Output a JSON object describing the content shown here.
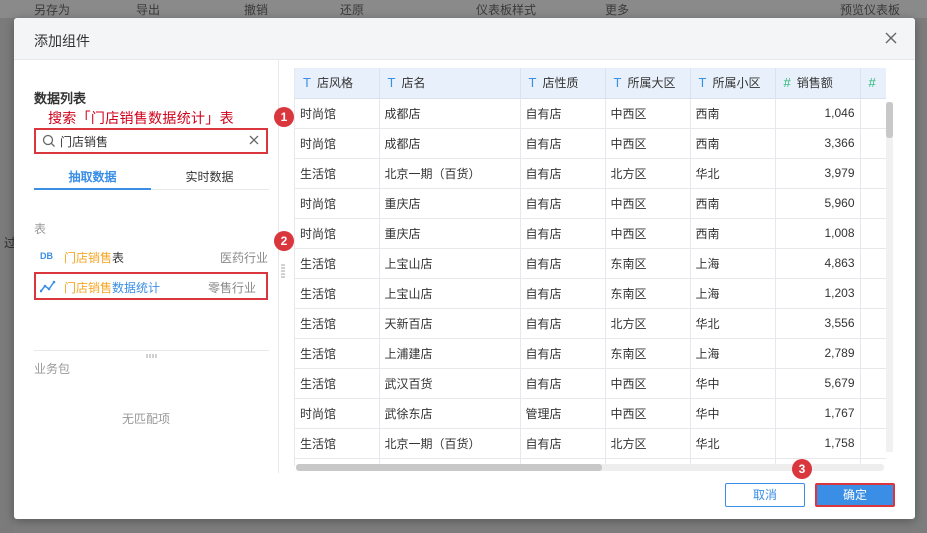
{
  "background_toolbar": {
    "items": [
      "另存为",
      "导出",
      "撤销",
      "还原",
      "仪表板样式",
      "更多",
      "预览仪表板"
    ],
    "side_text": "过"
  },
  "dialog": {
    "title": "添加组件"
  },
  "left_panel": {
    "datalist_label": "数据列表",
    "annotation": "搜索「门店销售数据统计」表",
    "search": {
      "value": "门店销售",
      "placeholder": ""
    },
    "tabs": [
      {
        "label": "抽取数据",
        "active": true
      },
      {
        "label": "实时数据",
        "active": false
      }
    ],
    "table_section_label": "表",
    "tables": [
      {
        "icon": "DB",
        "highlight": "门店销售",
        "rest": "表",
        "industry": "医药行业",
        "selected": false
      },
      {
        "icon": "chart",
        "highlight": "门店销售",
        "rest": "数据统计",
        "industry": "零售行业",
        "selected": true
      }
    ],
    "business_pack_label": "业务包",
    "empty_text": "无匹配项"
  },
  "data_table": {
    "columns": [
      {
        "type": "T",
        "label": "店风格"
      },
      {
        "type": "T",
        "label": "店名"
      },
      {
        "type": "T",
        "label": "店性质"
      },
      {
        "type": "T",
        "label": "所属大区"
      },
      {
        "type": "T",
        "label": "所属小区"
      },
      {
        "type": "#",
        "label": "销售额"
      },
      {
        "type": "#",
        "label": ""
      }
    ],
    "rows": [
      [
        "时尚馆",
        "成都店",
        "自有店",
        "中西区",
        "西南",
        "1,046"
      ],
      [
        "时尚馆",
        "成都店",
        "自有店",
        "中西区",
        "西南",
        "3,366"
      ],
      [
        "生活馆",
        "北京一期（百货）",
        "自有店",
        "北方区",
        "华北",
        "3,979"
      ],
      [
        "时尚馆",
        "重庆店",
        "自有店",
        "中西区",
        "西南",
        "5,960"
      ],
      [
        "时尚馆",
        "重庆店",
        "自有店",
        "中西区",
        "西南",
        "1,008"
      ],
      [
        "生活馆",
        "上宝山店",
        "自有店",
        "东南区",
        "上海",
        "4,863"
      ],
      [
        "生活馆",
        "上宝山店",
        "自有店",
        "东南区",
        "上海",
        "1,203"
      ],
      [
        "生活馆",
        "天新百店",
        "自有店",
        "北方区",
        "华北",
        "3,556"
      ],
      [
        "生活馆",
        "上浦建店",
        "自有店",
        "东南区",
        "上海",
        "2,789"
      ],
      [
        "生活馆",
        "武汉百货",
        "自有店",
        "中西区",
        "华中",
        "5,679"
      ],
      [
        "时尚馆",
        "武徐东店",
        "管理店",
        "中西区",
        "华中",
        "1,767"
      ],
      [
        "生活馆",
        "北京一期（百货）",
        "自有店",
        "北方区",
        "华北",
        "1,758"
      ],
      [
        "",
        "",
        "",
        "",
        "",
        ""
      ]
    ]
  },
  "footer": {
    "cancel_label": "取消",
    "ok_label": "确定"
  },
  "markers": [
    "1",
    "2",
    "3"
  ],
  "colors": {
    "accent": "#3a8ee6",
    "annotation_red": "#d9363e",
    "highlight_orange": "#f5a623",
    "header_bg": "#e8f1fb"
  }
}
